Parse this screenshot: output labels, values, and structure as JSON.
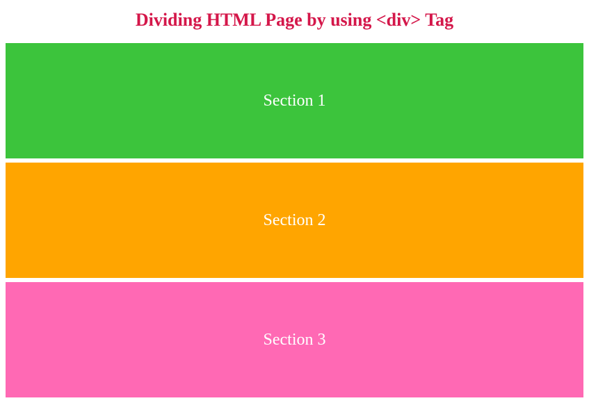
{
  "title": "Dividing HTML Page by using <div> Tag",
  "sections": [
    {
      "label": "Section 1",
      "color": "#3cc43c"
    },
    {
      "label": "Section 2",
      "color": "#ffa500"
    },
    {
      "label": "Section 3",
      "color": "#ff69b4"
    }
  ]
}
